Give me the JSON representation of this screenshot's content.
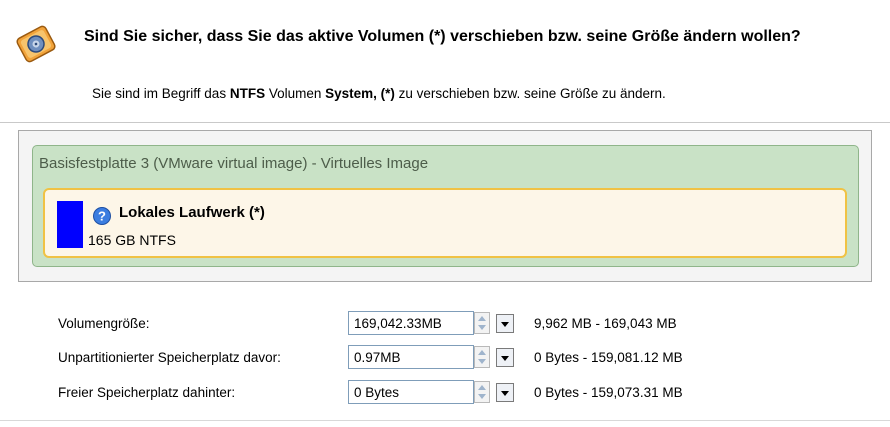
{
  "header": {
    "title": "Sind Sie sicher, dass Sie das aktive Volumen (*) verschieben bzw. seine Größe ändern wollen?",
    "subtitle_pre": "Sie sind im Begriff das ",
    "subtitle_fs": "NTFS",
    "subtitle_mid": " Volumen ",
    "subtitle_vol": "System, (*)",
    "subtitle_post": " zu verschieben bzw. seine Größe zu ändern.",
    "icon": "disk-warning-icon"
  },
  "disk": {
    "label": "Basisfestplatte 3 (VMware virtual image) - Virtuelles Image",
    "volume": {
      "name": "Lokales Laufwerk (*)",
      "size": "165 GB NTFS",
      "bar_color": "#0000ff",
      "help_icon": "help-icon"
    }
  },
  "params": [
    {
      "label": "Volumengröße:",
      "value": "169,042.33MB",
      "range": "9,962 MB - 169,043 MB"
    },
    {
      "label": "Unpartitionierter Speicherplatz davor:",
      "value": "0.97MB",
      "range": "0 Bytes - 159,081.12 MB"
    },
    {
      "label": "Freier Speicherplatz dahinter:",
      "value": "0 Bytes",
      "range": "0 Bytes - 159,073.31 MB"
    }
  ]
}
